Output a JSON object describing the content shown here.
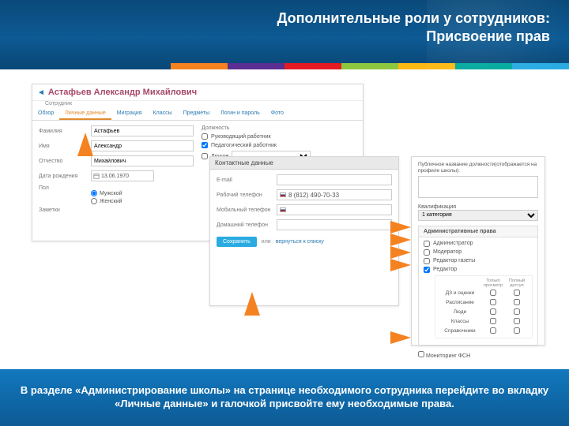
{
  "slide": {
    "title_line1": "Дополнительные роли у сотрудников:",
    "title_line2": "Присвоение прав"
  },
  "employee": {
    "full_name": "Астафьев Александр Михайлович",
    "breadcrumb": "Сотрудник"
  },
  "tabs": [
    "Обзор",
    "Личные данные",
    "Миграция",
    "Классы",
    "Предметы",
    "Логин и пароль",
    "Фото"
  ],
  "labels": {
    "surname": "Фамилия",
    "name": "Имя",
    "patronymic": "Отчество",
    "dob": "Дата рождения",
    "sex": "Пол",
    "notes": "Заметки",
    "position": "Должность",
    "contact_title": "Контактные данные",
    "email": "E-mail",
    "work_phone": "Рабочий телефон",
    "mobile_phone": "Мобильный телефон",
    "home_phone": "Домашний телефон",
    "save": "Сохранить",
    "or": "или",
    "back_list": "вернуться к списку",
    "public_title": "Публичное название должности(отображается на профиле школы):",
    "qualification": "Квалификация",
    "admin_rights": "Административные права",
    "col_view": "Только просмотр",
    "col_full": "Полный доступ"
  },
  "values": {
    "surname": "Астафьев",
    "name": "Александр",
    "patronymic": "Михайлович",
    "dob": "13.06.1970",
    "work_phone": "8 (812) 490-70-33",
    "qualification_selected": "1 категория"
  },
  "sex_options": [
    "Мужской",
    "Женский"
  ],
  "positions": [
    {
      "label": "Руководящий работник",
      "checked": false
    },
    {
      "label": "Педагогический работник",
      "checked": true
    },
    {
      "label": "Другое",
      "checked": false
    }
  ],
  "admin_roles": [
    {
      "label": "Администратор",
      "checked": false
    },
    {
      "label": "Модератор",
      "checked": false
    },
    {
      "label": "Редактор газеты",
      "checked": false
    },
    {
      "label": "Редактор",
      "checked": true
    }
  ],
  "perm_rows": [
    "ДЗ и оценки",
    "Расписание",
    "Люди",
    "Классы",
    "Справочники"
  ],
  "fsn": "Мониторинг ФСН",
  "footer": "В разделе «Администрирование школы» на странице необходимого сотрудника перейдите во вкладку «Личные данные» и галочкой присвойте ему необходимые права."
}
